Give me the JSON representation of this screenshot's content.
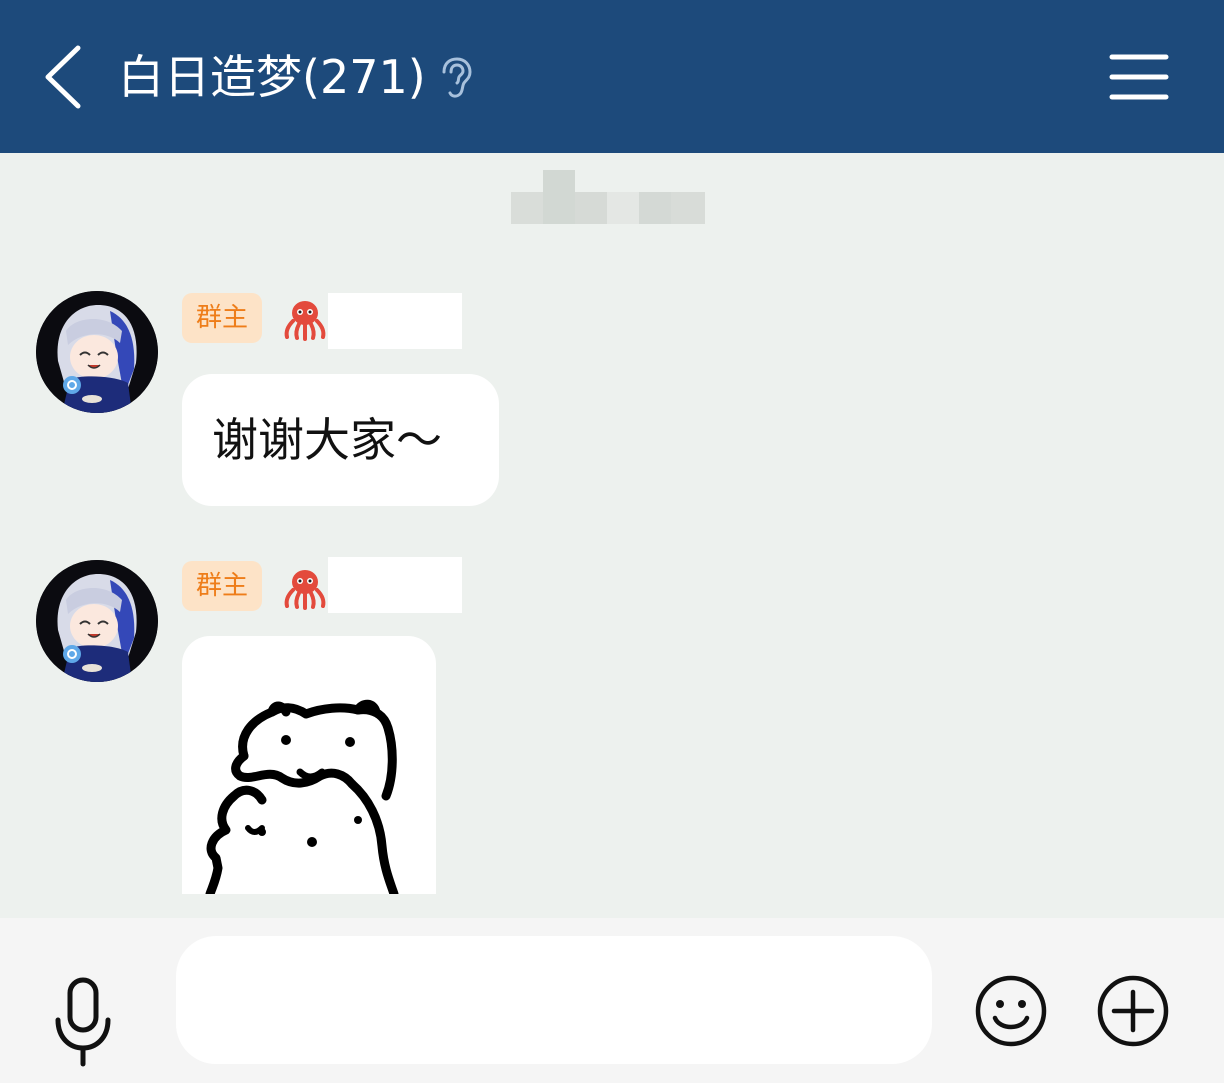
{
  "header": {
    "title": "白日造梦(271)",
    "back_icon": "chevron-left-icon",
    "ear_icon": "ear-icon",
    "menu_icon": "hamburger-menu-icon"
  },
  "colors": {
    "header_bg": "#1d4a7b",
    "chat_bg": "#edf1ee",
    "badge_bg": "#fde3c7",
    "badge_text": "#ee7d19",
    "bubble_bg": "#ffffff",
    "input_bar_bg": "#f5f5f5"
  },
  "messages": [
    {
      "role_badge": "群主",
      "sender_icon": "octopus-icon",
      "type": "text",
      "text": "谢谢大家～"
    },
    {
      "role_badge": "群主",
      "sender_icon": "octopus-icon",
      "type": "sticker",
      "sticker": "cat-sticker"
    }
  ],
  "composer": {
    "mic_icon": "microphone-icon",
    "input_value": "",
    "emoji_icon": "smiley-icon",
    "plus_icon": "plus-circle-icon"
  }
}
